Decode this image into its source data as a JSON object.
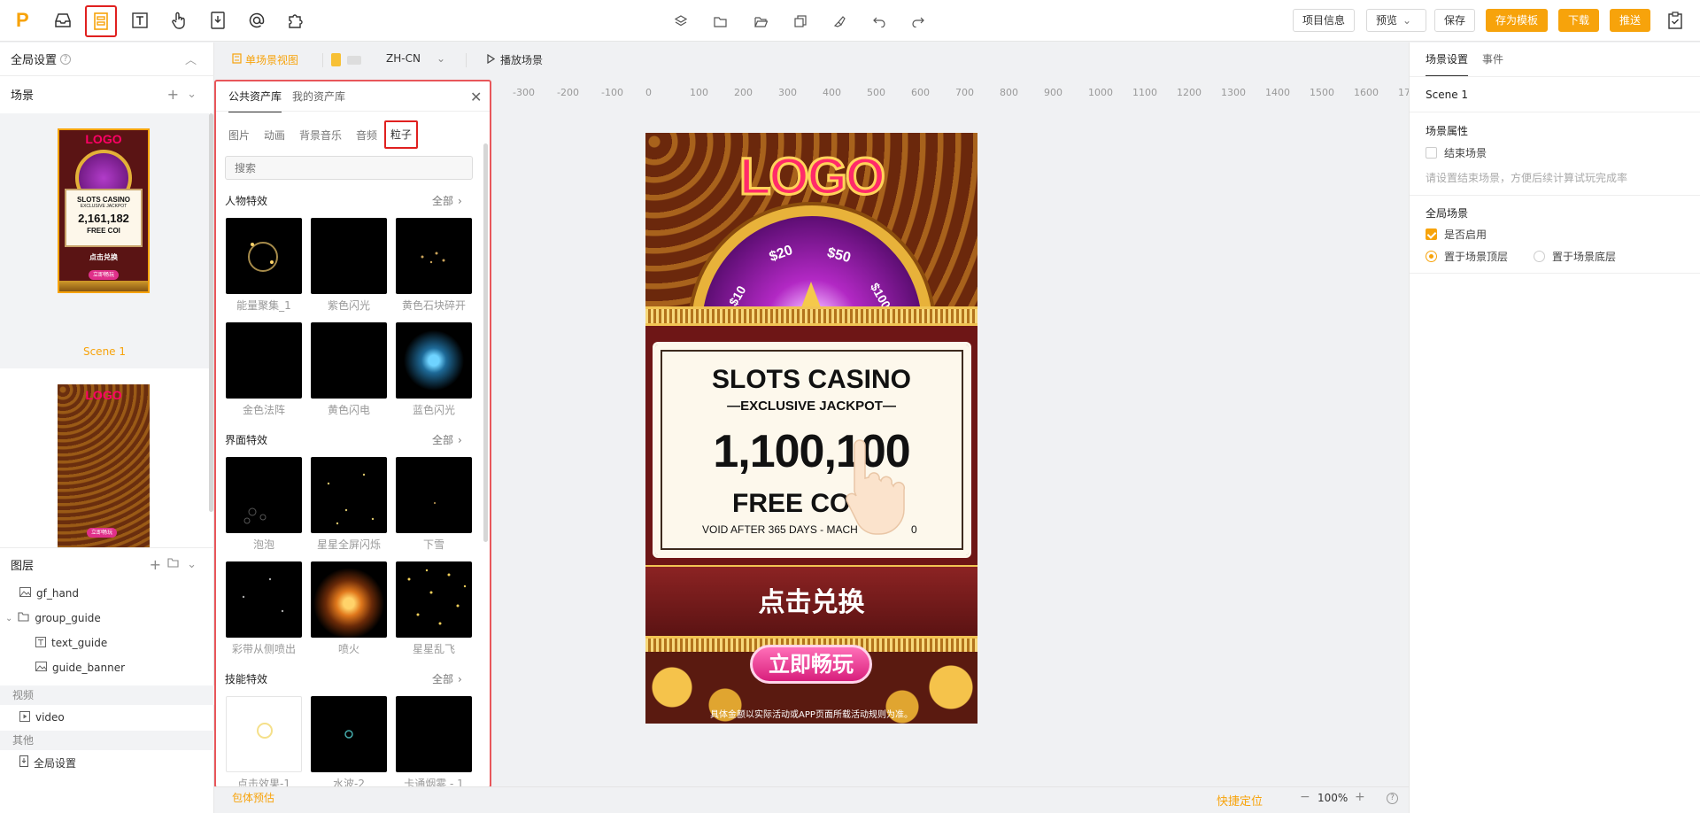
{
  "app": {
    "brand_letter": "P",
    "accent": "#f7a30b",
    "highlight_border": "#e0201f"
  },
  "toolbar": {
    "left_icons": [
      "inbox-icon",
      "scene-layout-icon",
      "text-icon",
      "pointer-hand-icon",
      "import-icon",
      "at-icon",
      "plugin-icon"
    ],
    "center_icons": [
      "layers-icon",
      "folder-icon",
      "folder-open-icon",
      "copy-icon",
      "brush-icon",
      "undo-icon",
      "redo-icon"
    ],
    "project_info": "项目信息",
    "preview": "预览",
    "save": "保存",
    "save_template": "存为模板",
    "download": "下载",
    "push": "推送"
  },
  "left": {
    "global_settings": "全局设置",
    "scene_header": "场景",
    "scene1_label": "Scene 1",
    "layers_header": "图层",
    "layers": [
      {
        "name": "gf_hand"
      },
      {
        "name": "group_guide"
      },
      {
        "name": "text_guide"
      },
      {
        "name": "guide_banner"
      }
    ],
    "video_cat": "视频",
    "video_item": "video",
    "other_cat": "其他",
    "global_item": "全局设置"
  },
  "canvas_toolbar": {
    "single_view": "单场景视图",
    "lang": "ZH-CN",
    "play_scene": "播放场景"
  },
  "ruler": [
    "-300",
    "-200",
    "-100",
    "0",
    "100",
    "200",
    "300",
    "400",
    "500",
    "600",
    "700",
    "800",
    "900",
    "1000",
    "1100",
    "1200",
    "1300",
    "1400",
    "1500",
    "1600",
    "17"
  ],
  "assets": {
    "tab_public": "公共资产库",
    "tab_mine": "我的资产库",
    "subtabs": [
      "图片",
      "动画",
      "背景音乐",
      "音频",
      "粒子"
    ],
    "search_placeholder": "搜索",
    "sections": [
      {
        "title": "人物特效",
        "more": "全部",
        "items": [
          "能量聚集_1",
          "紫色闪光",
          "黄色石块碎开",
          "金色法阵",
          "黄色闪电",
          "蓝色闪光"
        ]
      },
      {
        "title": "界面特效",
        "more": "全部",
        "items": [
          "泡泡",
          "星星全屏闪烁",
          "下雪",
          "彩带从侧喷出",
          "喷火",
          "星星乱飞"
        ]
      },
      {
        "title": "技能特效",
        "more": "全部",
        "items": [
          "点击效果-1",
          "水波-2",
          "卡通烟雾 - 1"
        ]
      }
    ]
  },
  "scene_preview": {
    "logo": "LOGO",
    "wheel_values": [
      "$10",
      "$20",
      "$50",
      "$100"
    ],
    "title": "SLOTS CASINO",
    "subtitle": "EXCLUSIVE JACKPOT",
    "amount": "1,100,100",
    "free_coins": "FREE COI",
    "void": "VOID AFTER 365 DAYS - MACH",
    "void_tail": "0",
    "redeem": "点击兑换",
    "play": "立即畅玩",
    "disclaimer": "具体金额以实际活动或APP页面所载活动规则为准。"
  },
  "thumb": {
    "title": "SLOTS CASINO",
    "sub": "EXCLUSIVE JACKPOT",
    "amount": "2,161,182",
    "free": "FREE COI",
    "redeem": "点击兑换",
    "play": "立即畅玩",
    "logo": "LOGO"
  },
  "right": {
    "tab_scene": "场景设置",
    "tab_event": "事件",
    "scene_name": "Scene 1",
    "scene_props": "场景属性",
    "end_scene": "结束场景",
    "end_hint": "请设置结束场景，方便后续计算试玩完成率",
    "global_scene": "全局场景",
    "enabled": "是否启用",
    "top_layer": "置于场景顶层",
    "bottom_layer": "置于场景底层"
  },
  "bottom": {
    "package_estimate": "包体预估",
    "quick_locate": "快捷定位",
    "zoom": "100%"
  }
}
